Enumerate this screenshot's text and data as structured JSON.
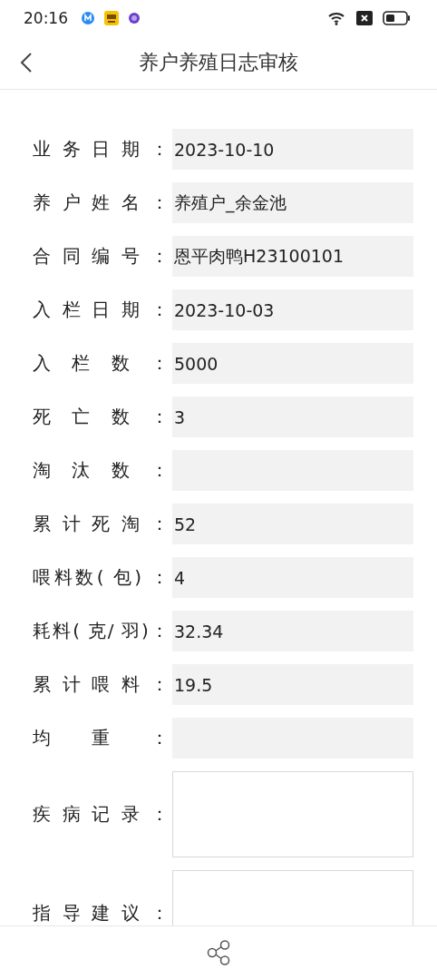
{
  "status_bar": {
    "time": "20:16"
  },
  "header": {
    "title": "养户养殖日志审核"
  },
  "fields": [
    {
      "kind": "text",
      "label": "业务日期：",
      "value": "2023-10-10"
    },
    {
      "kind": "text",
      "label": "养户姓名：",
      "value": "养殖户_余金池"
    },
    {
      "kind": "text",
      "label": "合同编号：",
      "value": "恩平肉鸭H23100101"
    },
    {
      "kind": "text",
      "label": "入栏日期：",
      "value": "2023-10-03"
    },
    {
      "kind": "text",
      "label": "入栏数：",
      "value": "5000"
    },
    {
      "kind": "text",
      "label": "死亡数：",
      "value": "3"
    },
    {
      "kind": "text",
      "label": "淘汰数："
    },
    {
      "kind": "text",
      "label": "累计死淘：",
      "value": "52"
    },
    {
      "kind": "text",
      "label": "喂料数( 包) ：",
      "value": "4"
    },
    {
      "kind": "text",
      "label": "耗料( 克/ 羽)：",
      "value": "32.34"
    },
    {
      "kind": "text",
      "label": "累计喂料：",
      "value": "19.5"
    },
    {
      "kind": "text",
      "label": "均重："
    },
    {
      "kind": "area",
      "label": "疾病记录："
    },
    {
      "kind": "area",
      "label": "指导建议："
    }
  ]
}
